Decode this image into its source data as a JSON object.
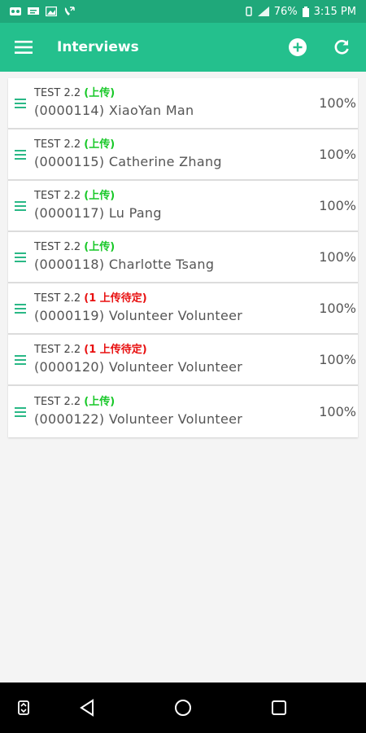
{
  "status_bar": {
    "battery": "76%",
    "time": "3:15 PM"
  },
  "app_bar": {
    "title": "Interviews",
    "menu_icon": "hamburger-menu-icon",
    "add_icon": "add-circle-icon",
    "refresh_icon": "refresh-icon"
  },
  "colors": {
    "status_bar": "#1fa87a",
    "app_bar": "#24c08d",
    "uploaded": "#18c828",
    "pending": "#e81010",
    "handle": "#2ab886"
  },
  "interviews": [
    {
      "survey": "TEST 2.2",
      "status": "(上传)",
      "status_type": "uploaded",
      "name": "(0000114) XiaoYan Man",
      "percent": "100%"
    },
    {
      "survey": "TEST 2.2",
      "status": "(上传)",
      "status_type": "uploaded",
      "name": "(0000115) Catherine Zhang",
      "percent": "100%"
    },
    {
      "survey": "TEST 2.2",
      "status": "(上传)",
      "status_type": "uploaded",
      "name": "(0000117) Lu Pang",
      "percent": "100%"
    },
    {
      "survey": "TEST 2.2",
      "status": "(上传)",
      "status_type": "uploaded",
      "name": "(0000118) Charlotte Tsang",
      "percent": "100%"
    },
    {
      "survey": "TEST 2.2",
      "status": "(1 上传待定)",
      "status_type": "pending",
      "name": "(0000119) Volunteer Volunteer",
      "percent": "100%"
    },
    {
      "survey": "TEST 2.2",
      "status": "(1 上传待定)",
      "status_type": "pending",
      "name": "(0000120) Volunteer Volunteer",
      "percent": "100%"
    },
    {
      "survey": "TEST 2.2",
      "status": "(上传)",
      "status_type": "uploaded",
      "name": "(0000122) Volunteer Volunteer",
      "percent": "100%"
    }
  ],
  "nav_bar": {
    "icons": [
      "toggle-nav-icon",
      "back-icon",
      "home-icon",
      "recents-icon"
    ]
  }
}
